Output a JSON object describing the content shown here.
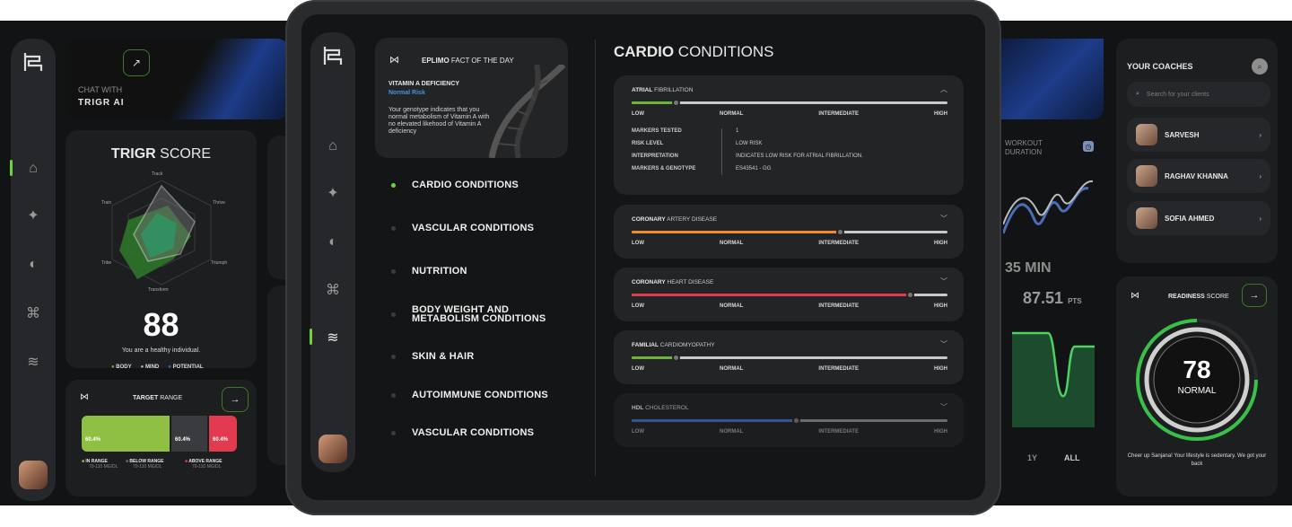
{
  "left_panel": {
    "chat": {
      "label": "CHAT WITH",
      "brand": "TRIGR AI"
    },
    "score": {
      "title_bold": "TRIGR",
      "title_light": "SCORE",
      "axes": [
        "Track",
        "Thrive",
        "Triumph",
        "Transform",
        "Tribe",
        "Train"
      ],
      "value": "88",
      "caption": "You are a healthy individual.",
      "legend": [
        "BODY",
        "MIND",
        "POTENTIAL"
      ]
    },
    "target": {
      "title_bold": "TARGET",
      "title_light": "RANGE",
      "segments": [
        {
          "value": "60.4%",
          "color": "#8fc044"
        },
        {
          "value": "60.4%",
          "color": "#3a3b3f"
        },
        {
          "value": "60.4%",
          "color": "#e23a4f"
        }
      ],
      "legend": [
        {
          "label": "IN RANGE",
          "sub": "70-110 MG/DL",
          "color": "#8fc044"
        },
        {
          "label": "BELOW RANGE",
          "sub": "70-110 MG/DL",
          "color": "#6b6c70"
        },
        {
          "label": "ABOVE RANGE",
          "sub": "70-110 MG/DL",
          "color": "#e23a4f"
        }
      ]
    }
  },
  "center": {
    "fact": {
      "title_bold": "EPLIMO",
      "title_light": "FACT OF THE DAY",
      "heading": "VITAMIN A DEFICIENCY",
      "risk": "Normal Risk",
      "body": "Your genotype indicates that you normal metabolism of Vitamin A with no elevated likehood of Vitamin A deficiency"
    },
    "nav": [
      {
        "label": "CARDIO CONDITIONS",
        "active": true
      },
      {
        "label": "VASCULAR CONDITIONS",
        "active": false
      },
      {
        "label": "NUTRITION",
        "active": false
      },
      {
        "label": "BODY WEIGHT AND METABOLISM CONDITIONS",
        "active": false
      },
      {
        "label": "SKIN & HAIR",
        "active": false
      },
      {
        "label": "AUTOIMMUNE CONDITIONS",
        "active": false
      },
      {
        "label": "VASCULAR CONDITIONS",
        "active": false
      }
    ],
    "section_title_bold": "CARDIO",
    "section_title_light": "CONDITIONS",
    "scale_labels": [
      "LOW",
      "NORMAL",
      "INTERMEDIATE",
      "HIGH"
    ],
    "conditions": [
      {
        "name_bold": "ATRIAL",
        "name_light": "FIBRILLATION",
        "level": 0.14,
        "color": "#6fb23a",
        "expanded": true
      },
      {
        "name_bold": "CORONARY",
        "name_light": "ARTERY DISEASE",
        "level": 0.66,
        "color": "#f28a2e",
        "expanded": false
      },
      {
        "name_bold": "CORONARY",
        "name_light": "HEART DISEASE",
        "level": 0.88,
        "color": "#e23a4f",
        "expanded": false
      },
      {
        "name_bold": "FAMILIAL",
        "name_light": "CARDIOMYOPATHY",
        "level": 0.14,
        "color": "#6fb23a",
        "expanded": false
      },
      {
        "name_bold": "HDL",
        "name_light": "CHOLESTEROL",
        "level": 0.52,
        "color": "#3a6fb8",
        "expanded": false
      }
    ],
    "details": [
      {
        "k": "MARKERS TESTED",
        "v": "1"
      },
      {
        "k": "RISK LEVEL",
        "v": "LOW RISK"
      },
      {
        "k": "INTERPRETATION",
        "v": "INDICATES LOW RISK FOR ATRIAL FIBRILLATION."
      },
      {
        "k": "MARKERS & GENOTYPE",
        "v": "ES43541 - GG"
      }
    ]
  },
  "right_panel": {
    "workout": {
      "title": "WORKOUT DURATION",
      "value": "35 MIN"
    },
    "points": {
      "value": "87.51",
      "unit": "PTS",
      "ranges": [
        "1Y",
        "ALL"
      ]
    },
    "coaches": {
      "title": "YOUR COACHES",
      "search_placeholder": "Search for your clients",
      "list": [
        "SARVESH",
        "RAGHAV KHANNA",
        "SOFIA AHMED"
      ]
    },
    "readiness": {
      "title_bold": "READINESS",
      "title_light": "SCORE",
      "value": "78",
      "status": "NORMAL",
      "message": "Cheer up Sanjana! Your lifestyle is sedentary. We got your back"
    }
  }
}
